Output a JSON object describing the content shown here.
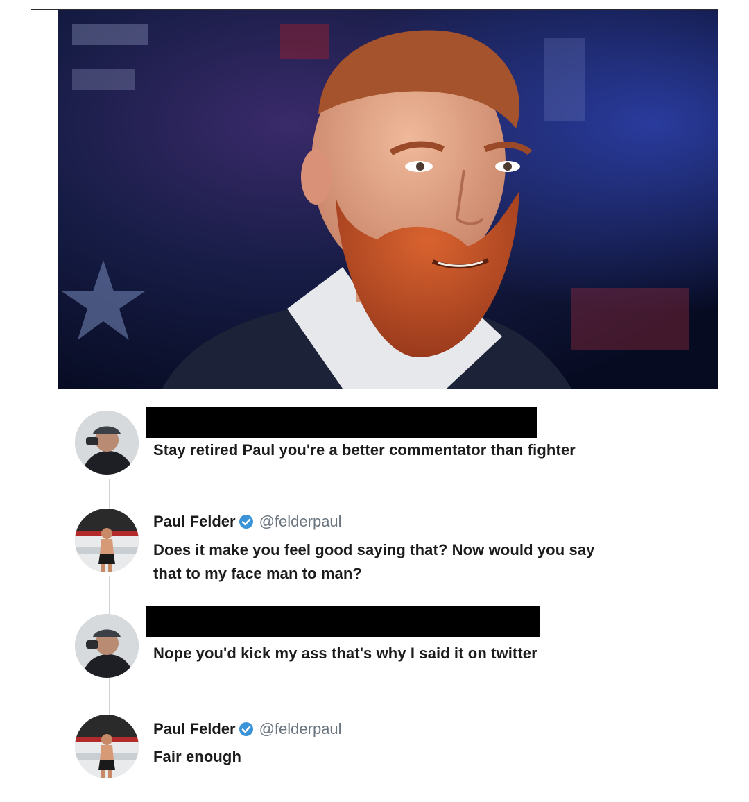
{
  "photo": {
    "alt": "photo-header",
    "colors": {
      "background": "#0c1230",
      "beard": "#c8542a",
      "skin": "#e2a787",
      "shirt": "#e6e8ec",
      "jacket": "#1c2238"
    }
  },
  "tweets": [
    {
      "author_redacted": true,
      "text": "Stay retired Paul you're a better commentator than fighter",
      "avatar_icon": "user-avatar-photo-icon"
    },
    {
      "author_name": "Paul Felder",
      "handle": "@felderpaul",
      "verified": true,
      "text_line1": "Does it make you feel good saying that? Now would you say",
      "text_line2": "that to my face man to man?",
      "avatar_icon": "paul-felder-avatar-icon"
    },
    {
      "author_redacted": true,
      "text": "Nope you'd kick my ass that's why I said it on twitter",
      "avatar_icon": "user-avatar-photo-icon"
    },
    {
      "author_name": "Paul Felder",
      "handle": "@felderpaul",
      "verified": true,
      "text": "Fair enough",
      "avatar_icon": "paul-felder-avatar-icon"
    }
  ],
  "colors": {
    "verified_badge": "#3b93d8",
    "handle": "#6a7580",
    "redaction": "#000000",
    "thread_line": "#cfd3d7"
  }
}
